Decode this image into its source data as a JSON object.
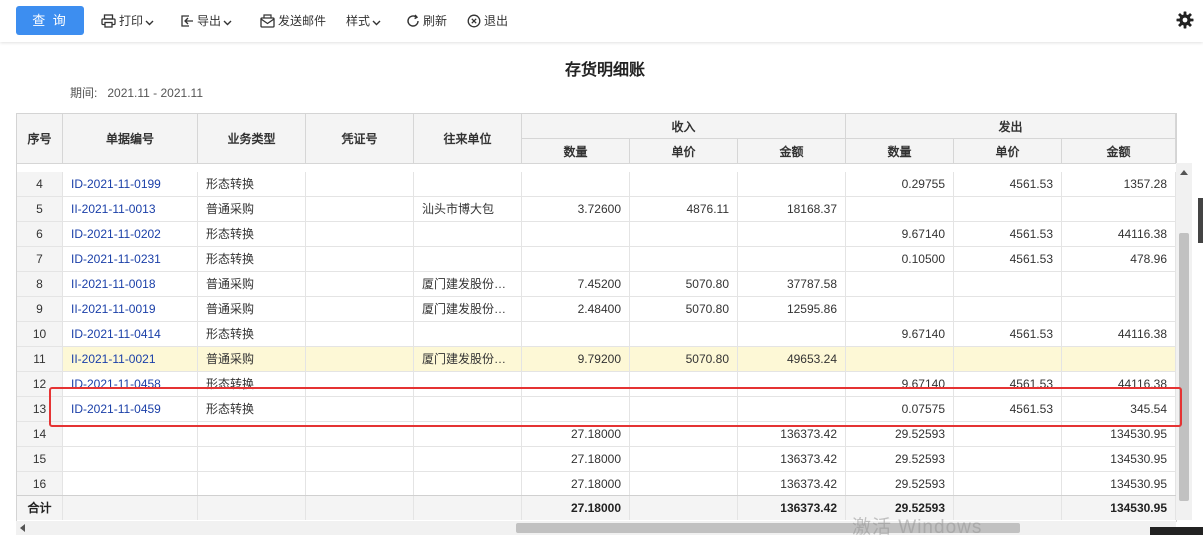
{
  "toolbar": {
    "query": "查 询",
    "print": "打印",
    "export": "导出",
    "send_mail": "发送邮件",
    "style": "样式",
    "refresh": "刷新",
    "exit": "退出"
  },
  "report": {
    "title": "存货明细账",
    "period_label": "期间:",
    "period_value": "2021.11 - 2021.11"
  },
  "table": {
    "headers": {
      "seq": "序号",
      "doc_no": "单据编号",
      "biz_type": "业务类型",
      "voucher": "凭证号",
      "partner": "往来单位",
      "income": "收入",
      "outgo": "发出",
      "qty": "数量",
      "price": "单价",
      "amount": "金额"
    },
    "rows": [
      {
        "seq": "4",
        "doc": "ID-2021-11-0199",
        "type": "形态转换",
        "voucher": "",
        "partner": "",
        "in_qty": "",
        "in_price": "",
        "in_amt": "",
        "out_qty": "0.29755",
        "out_price": "4561.53",
        "out_amt": "1357.28"
      },
      {
        "seq": "5",
        "doc": "II-2021-11-0013",
        "type": "普通采购",
        "voucher": "",
        "partner": "汕头市博大包",
        "in_qty": "3.72600",
        "in_price": "4876.11",
        "in_amt": "18168.37",
        "out_qty": "",
        "out_price": "",
        "out_amt": ""
      },
      {
        "seq": "6",
        "doc": "ID-2021-11-0202",
        "type": "形态转换",
        "voucher": "",
        "partner": "",
        "in_qty": "",
        "in_price": "",
        "in_amt": "",
        "out_qty": "9.67140",
        "out_price": "4561.53",
        "out_amt": "44116.38"
      },
      {
        "seq": "7",
        "doc": "ID-2021-11-0231",
        "type": "形态转换",
        "voucher": "",
        "partner": "",
        "in_qty": "",
        "in_price": "",
        "in_amt": "",
        "out_qty": "0.10500",
        "out_price": "4561.53",
        "out_amt": "478.96"
      },
      {
        "seq": "8",
        "doc": "II-2021-11-0018",
        "type": "普通采购",
        "voucher": "",
        "partner": "厦门建发股份有限公司",
        "in_qty": "7.45200",
        "in_price": "5070.80",
        "in_amt": "37787.58",
        "out_qty": "",
        "out_price": "",
        "out_amt": ""
      },
      {
        "seq": "9",
        "doc": "II-2021-11-0019",
        "type": "普通采购",
        "voucher": "",
        "partner": "厦门建发股份有限公司",
        "in_qty": "2.48400",
        "in_price": "5070.80",
        "in_amt": "12595.86",
        "out_qty": "",
        "out_price": "",
        "out_amt": ""
      },
      {
        "seq": "10",
        "doc": "ID-2021-11-0414",
        "type": "形态转换",
        "voucher": "",
        "partner": "",
        "in_qty": "",
        "in_price": "",
        "in_amt": "",
        "out_qty": "9.67140",
        "out_price": "4561.53",
        "out_amt": "44116.38"
      },
      {
        "seq": "11",
        "doc": "II-2021-11-0021",
        "type": "普通采购",
        "voucher": "",
        "partner": "厦门建发股份有限公司",
        "in_qty": "9.79200",
        "in_price": "5070.80",
        "in_amt": "49653.24",
        "out_qty": "",
        "out_price": "",
        "out_amt": ""
      },
      {
        "seq": "12",
        "doc": "ID-2021-11-0458",
        "type": "形态转换",
        "voucher": "",
        "partner": "",
        "in_qty": "",
        "in_price": "",
        "in_amt": "",
        "out_qty": "9.67140",
        "out_price": "4561.53",
        "out_amt": "44116.38"
      },
      {
        "seq": "13",
        "doc": "ID-2021-11-0459",
        "type": "形态转换",
        "voucher": "",
        "partner": "",
        "in_qty": "",
        "in_price": "",
        "in_amt": "",
        "out_qty": "0.07575",
        "out_price": "4561.53",
        "out_amt": "345.54"
      },
      {
        "seq": "14",
        "doc": "",
        "type": "",
        "voucher": "",
        "partner": "",
        "in_qty": "27.18000",
        "in_price": "",
        "in_amt": "136373.42",
        "out_qty": "29.52593",
        "out_price": "",
        "out_amt": "134530.95"
      },
      {
        "seq": "15",
        "doc": "",
        "type": "",
        "voucher": "",
        "partner": "",
        "in_qty": "27.18000",
        "in_price": "",
        "in_amt": "136373.42",
        "out_qty": "29.52593",
        "out_price": "",
        "out_amt": "134530.95"
      },
      {
        "seq": "16",
        "doc": "",
        "type": "",
        "voucher": "",
        "partner": "",
        "in_qty": "27.18000",
        "in_price": "",
        "in_amt": "136373.42",
        "out_qty": "29.52593",
        "out_price": "",
        "out_amt": "134530.95"
      }
    ],
    "total": {
      "label": "合计",
      "in_qty": "27.18000",
      "in_amt": "136373.42",
      "out_qty": "29.52593",
      "out_amt": "134530.95"
    }
  },
  "watermark": "激活 Windows",
  "colors": {
    "accent": "#3d8ef0",
    "highlight_row": "#fdf8d6",
    "annotation_box": "#e53333",
    "link": "#1a3fa8"
  }
}
